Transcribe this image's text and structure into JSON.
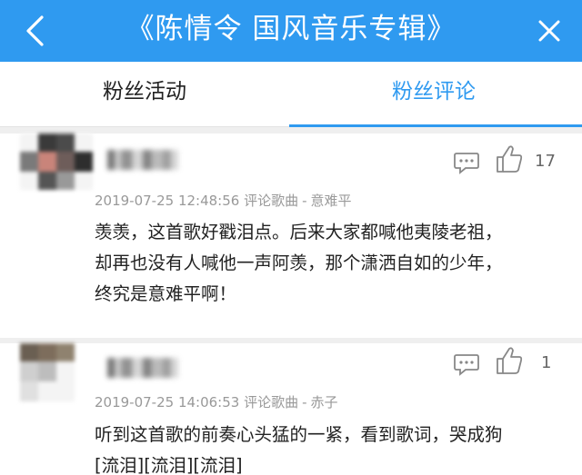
{
  "header": {
    "title": "《陈情令 国风音乐专辑》",
    "back_icon": "chevron-left-icon",
    "close_icon": "close-icon",
    "bg_color": "#2f9af0"
  },
  "tabs": [
    {
      "label": "粉丝活动",
      "active": false
    },
    {
      "label": "粉丝评论",
      "active": true
    }
  ],
  "accent_color": "#2f9af0",
  "comments": [
    {
      "time": "2019-07-25 12:48:56",
      "action": "评论歌曲",
      "separator": "-",
      "song": "意难平",
      "likes": "17",
      "lines": [
        "羡羡，这首歌好戳泪点。后来大家都喊他夷陵老祖，",
        "却再也没有人喊他一声阿羡，那个潇洒自如的少年，",
        "终究是意难平啊！"
      ]
    },
    {
      "time": "2019-07-25 14:06:53",
      "action": "评论歌曲",
      "separator": "-",
      "song": "赤子",
      "likes": "1",
      "lines": [
        "听到这首歌的前奏心头猛的一紧，看到歌词，哭成狗",
        "[流泪][流泪][流泪]"
      ]
    }
  ]
}
